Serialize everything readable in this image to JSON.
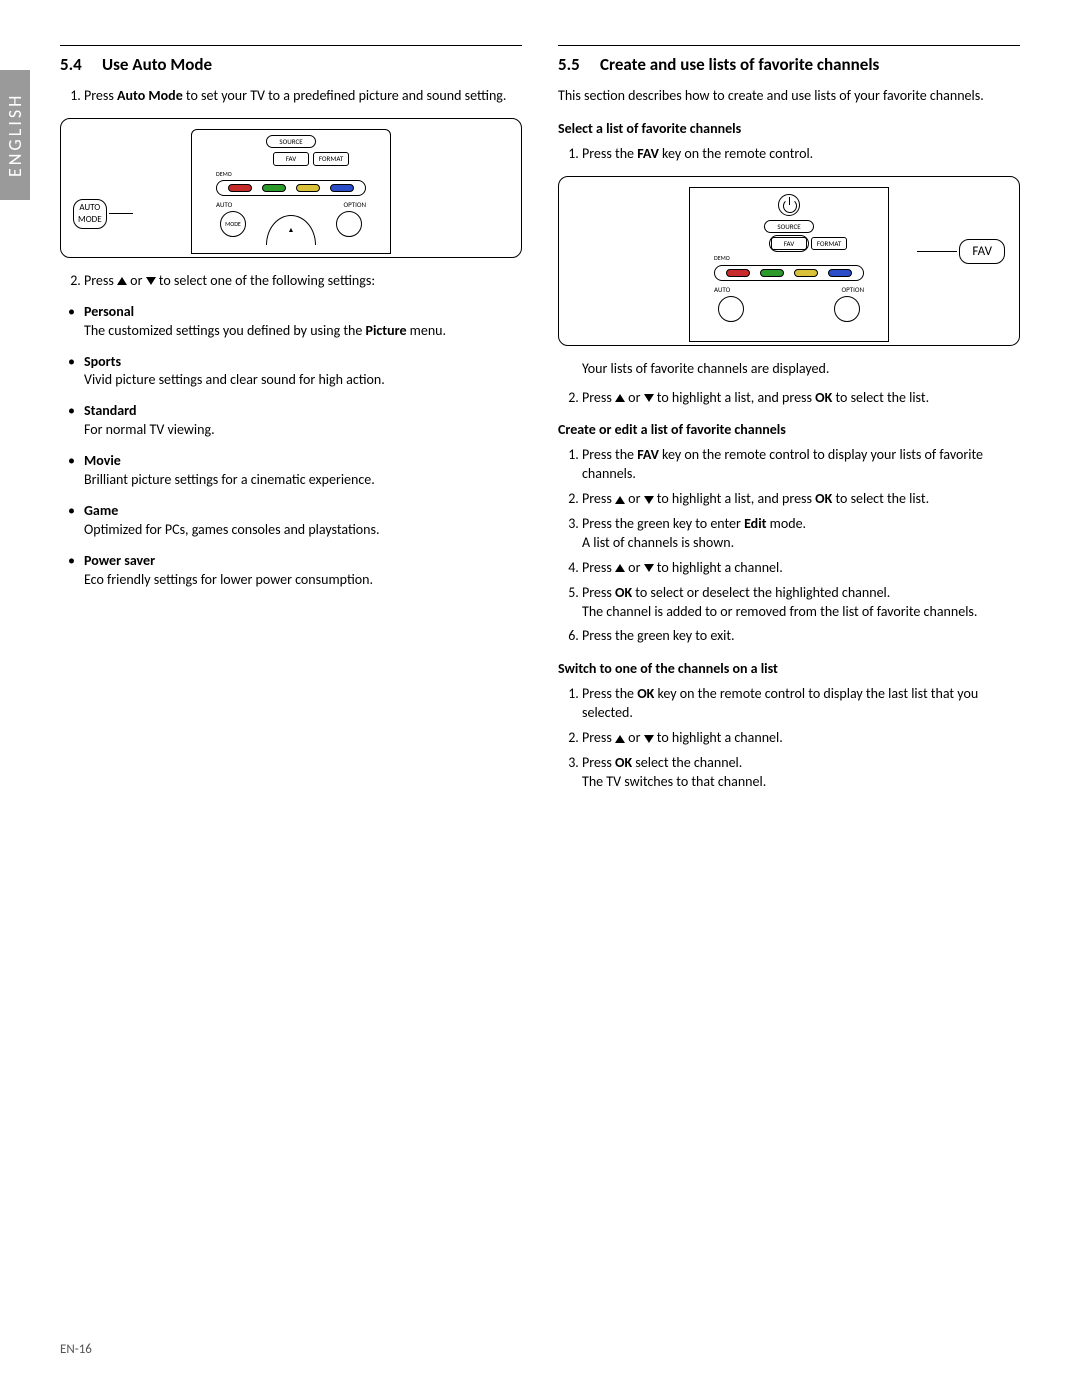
{
  "lang_tab": "ENGLISH",
  "page_number": "EN-16",
  "left": {
    "section_num": "5.4",
    "section_title": "Use Auto Mode",
    "step1_pre": "Press ",
    "step1_bold": "Auto Mode",
    "step1_post": " to set your TV to a predefined picture and sound setting.",
    "diagram": {
      "source": "SOURCE",
      "fav": "FAV",
      "format": "FORMAT",
      "demo": "DEMO",
      "auto": "AUTO",
      "option": "OPTION",
      "mode": "MODE",
      "callout_line1": "AUTO",
      "callout_line2": "MODE"
    },
    "step2_pre": "Press ",
    "step2_mid": " or ",
    "step2_post": " to select one of the following settings:",
    "modes": [
      {
        "name": "Personal",
        "desc_pre": "The customized settings you defined by using the ",
        "desc_bold": "Picture",
        "desc_post": " menu."
      },
      {
        "name": "Sports",
        "desc": "Vivid picture settings and clear sound for high action."
      },
      {
        "name": "Standard",
        "desc": "For normal TV viewing."
      },
      {
        "name": "Movie",
        "desc": "Brilliant picture settings for a cinematic experience."
      },
      {
        "name": "Game",
        "desc": "Optimized for PCs, games consoles and playstations."
      },
      {
        "name": "Power saver",
        "desc": "Eco friendly settings for lower power consumption."
      }
    ]
  },
  "right": {
    "section_num": "5.5",
    "section_title": "Create and use lists of favorite channels",
    "intro": "This section describes how to create and use lists of your favorite channels.",
    "sub1_title": "Select a list of favorite channels",
    "sub1_step1_pre": "Press the ",
    "sub1_step1_bold": "FAV",
    "sub1_step1_post": " key on the remote control.",
    "diagram": {
      "source": "SOURCE",
      "fav": "FAV",
      "format": "FORMAT",
      "demo": "DEMO",
      "auto": "AUTO",
      "option": "OPTION",
      "callout": "FAV"
    },
    "sub1_after": "Your lists of favorite channels are displayed.",
    "sub1_step2_pre": "Press ",
    "sub1_step2_mid": " or ",
    "sub1_step2_mid2": " to highlight a list, and press ",
    "sub1_step2_bold": "OK",
    "sub1_step2_post": " to select the list.",
    "sub2_title": "Create or edit a list of favorite channels",
    "sub2_steps": {
      "s1_pre": "Press the ",
      "s1_bold": "FAV",
      "s1_post": " key on the remote control to display your lists of favorite channels.",
      "s2_pre": "Press ",
      "s2_mid": " or ",
      "s2_mid2": " to highlight a list, and press ",
      "s2_bold": "OK",
      "s2_post": " to select the list.",
      "s3_pre": "Press the green key to enter ",
      "s3_bold": "Edit",
      "s3_post": " mode.",
      "s3_line2": "A list of channels is shown.",
      "s4_pre": "Press ",
      "s4_mid": " or ",
      "s4_post": " to highlight a channel.",
      "s5_pre": "Press ",
      "s5_bold": "OK",
      "s5_post": " to select or deselect the highlighted channel.",
      "s5_line2": "The channel is added to or removed from the list of favorite channels.",
      "s6": "Press the green key to exit."
    },
    "sub3_title": "Switch to one of the channels on a list",
    "sub3_steps": {
      "s1_pre": "Press the ",
      "s1_bold": "OK",
      "s1_post": " key on the remote control to display the last list that you selected.",
      "s2_pre": "Press ",
      "s2_mid": " or ",
      "s2_post": " to highlight a channel.",
      "s3_pre": "Press ",
      "s3_bold": "OK",
      "s3_post": " select the channel.",
      "s3_line2": "The TV switches to that channel."
    }
  }
}
